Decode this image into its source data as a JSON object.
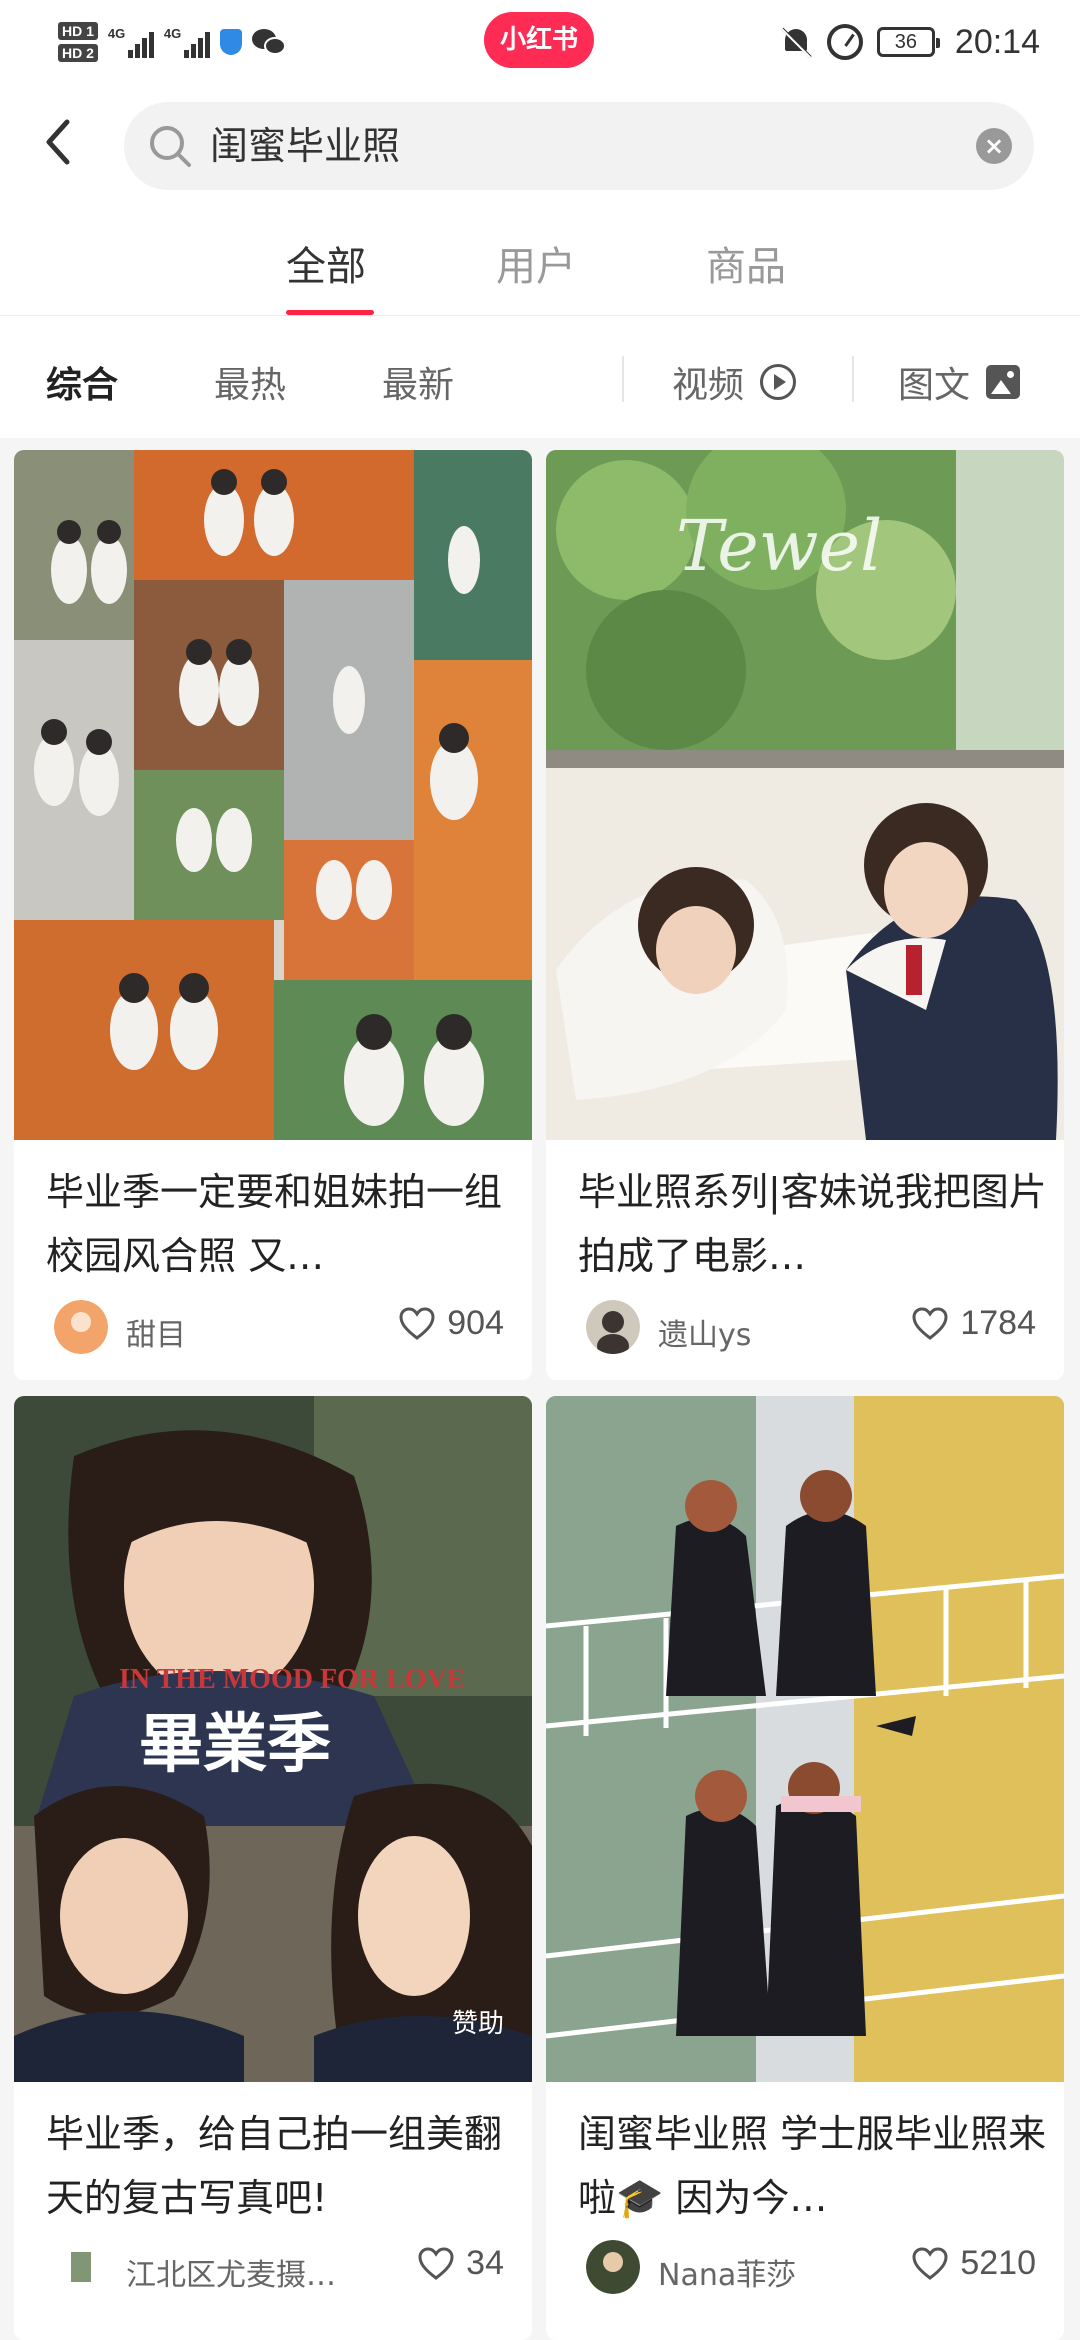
{
  "status_bar": {
    "hd1": "HD 1",
    "hd2": "HD 2",
    "network1": "4G",
    "network2": "4G",
    "app_badge": "小红书",
    "battery": "36",
    "time": "20:14"
  },
  "search": {
    "query": "闺蜜毕业照",
    "back_icon": "back-arrow-icon",
    "search_icon": "magnifier-icon",
    "clear_icon": "clear-icon"
  },
  "tabs": [
    {
      "label": "全部",
      "active": true
    },
    {
      "label": "用户",
      "active": false
    },
    {
      "label": "商品",
      "active": false
    }
  ],
  "filters": {
    "sort": [
      "综合",
      "最热",
      "最新"
    ],
    "video": "视频",
    "image_text": "图文"
  },
  "colors": {
    "accent": "#ff2442",
    "brand_pill": "#fe2c55"
  },
  "cards": [
    {
      "title": "毕业季一定要和姐妹拍一组校园风合照 又…",
      "author": "甜目",
      "likes": "904",
      "sponsor": ""
    },
    {
      "title": "毕业照系列|客妹说我把图片拍成了电影…",
      "author": "遗山ys",
      "likes": "1784",
      "sponsor": ""
    },
    {
      "title": "毕业季，给自己拍一组美翻天的复古写真吧!",
      "author": "江北区尤麦摄…",
      "likes": "34",
      "sponsor": "赞助"
    },
    {
      "title": "闺蜜毕业照 学士服毕业照来啦🎓 因为今…",
      "author": "Nana菲莎",
      "likes": "5210",
      "sponsor": ""
    }
  ]
}
